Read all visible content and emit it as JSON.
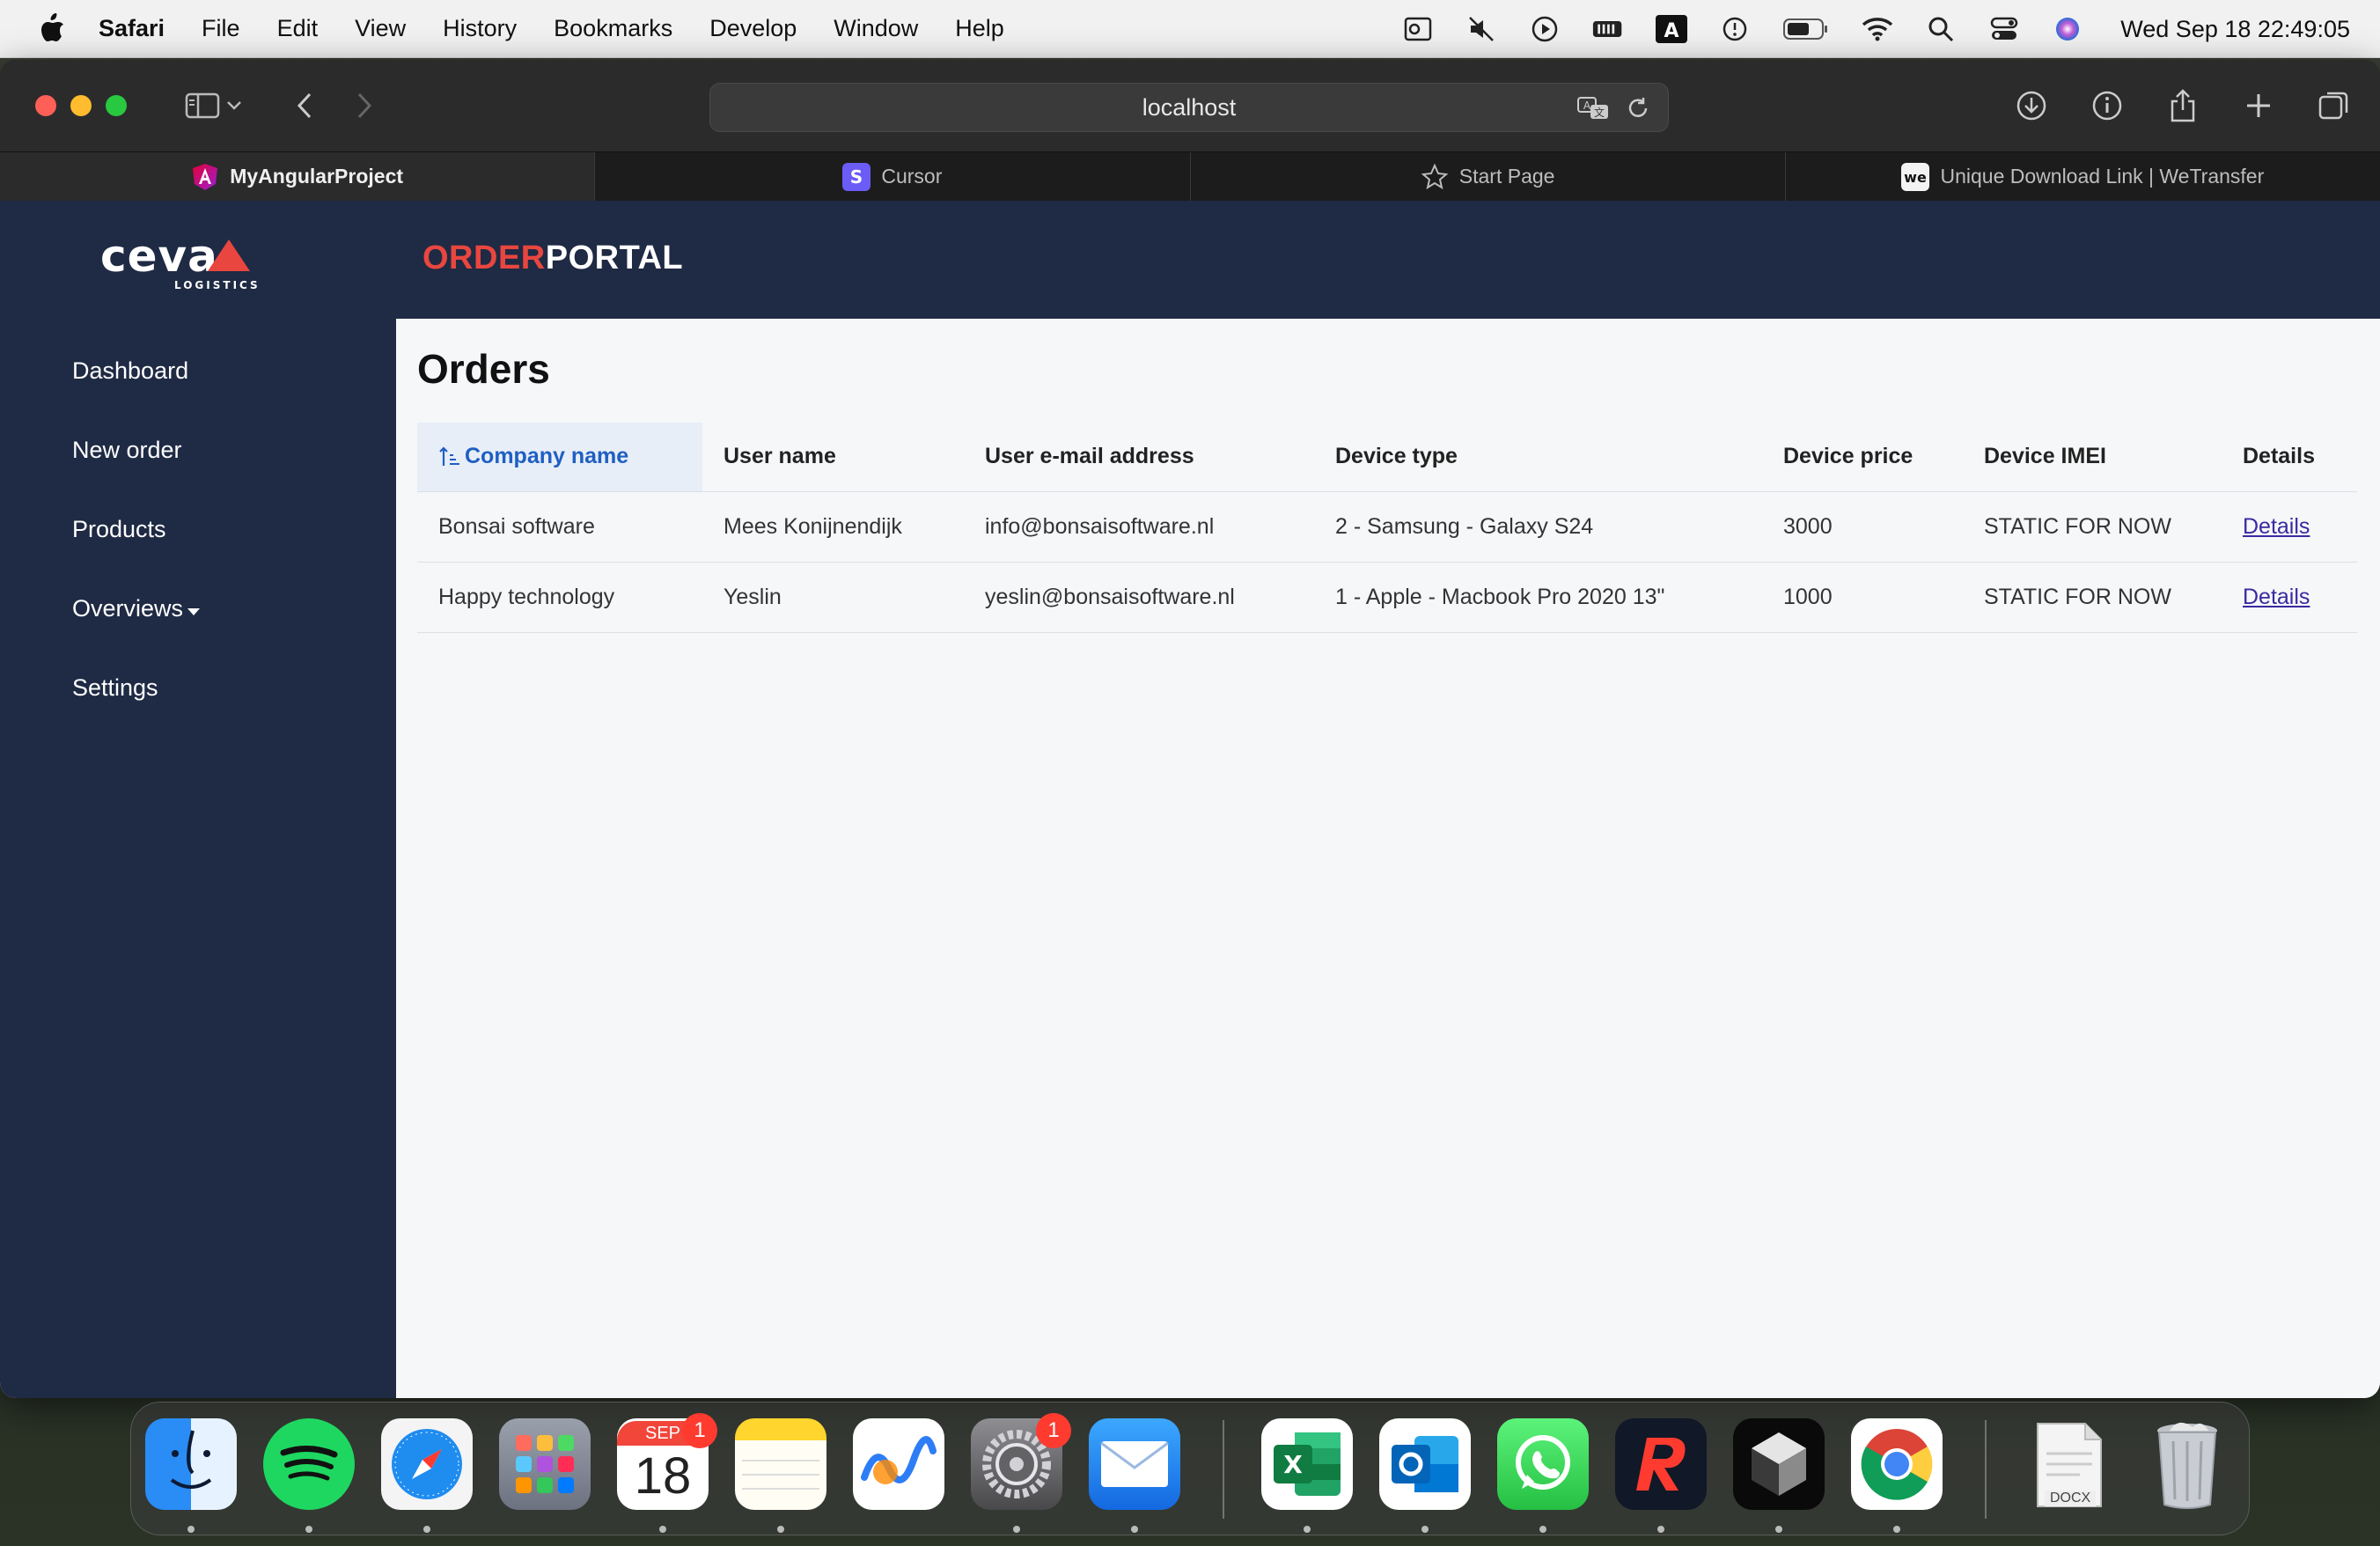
{
  "menubar": {
    "app_name": "Safari",
    "items": [
      "File",
      "Edit",
      "View",
      "History",
      "Bookmarks",
      "Develop",
      "Window",
      "Help"
    ],
    "clock": "Wed Sep 18  22:49:05",
    "status_icons": [
      "outlook-icon",
      "mute-icon",
      "play-icon",
      "battery-meter-icon",
      "keyboard-input-icon",
      "screen-time-icon",
      "battery-icon",
      "wifi-icon",
      "spotlight-icon",
      "control-center-icon",
      "siri-icon"
    ]
  },
  "browser": {
    "url": "localhost",
    "tabs": [
      {
        "label": "MyAngularProject",
        "icon": "angular-icon",
        "active": true
      },
      {
        "label": "Cursor",
        "icon": "cursor-icon",
        "active": false
      },
      {
        "label": "Start Page",
        "icon": "star-icon",
        "active": false
      },
      {
        "label": "Unique Download Link | WeTransfer",
        "icon": "wetransfer-icon",
        "active": false
      }
    ]
  },
  "site": {
    "logo_text": "ceva",
    "logo_sub": "LOGISTICS",
    "portal_accent": "ORDER",
    "portal_rest": "PORTAL",
    "accent_color": "#e8463f",
    "header_color": "#1f2a44"
  },
  "nav": {
    "dashboard": "Dashboard",
    "new_order": "New order",
    "products": "Products",
    "overviews": "Overviews",
    "settings": "Settings"
  },
  "orders": {
    "title": "Orders",
    "columns": [
      "Company name",
      "User name",
      "User e-mail address",
      "Device type",
      "Device price",
      "Device IMEI",
      "Details"
    ],
    "rows": [
      {
        "company": "Bonsai software",
        "user": "Mees Konijnendijk",
        "email": "info@bonsaisoftware.nl",
        "device": "2 - Samsung - Galaxy S24",
        "price": "3000",
        "imei": "STATIC FOR NOW",
        "details": "Details"
      },
      {
        "company": "Happy technology",
        "user": "Yeslin",
        "email": "yeslin@bonsaisoftware.nl",
        "device": "1 - Apple - Macbook Pro 2020 13\"",
        "price": "1000",
        "imei": "STATIC FOR NOW",
        "details": "Details"
      }
    ]
  },
  "dock": {
    "calendar_month": "SEP",
    "calendar_day": "18",
    "calendar_badge": "1",
    "settings_badge": "1",
    "docx_label": "DOCX"
  }
}
